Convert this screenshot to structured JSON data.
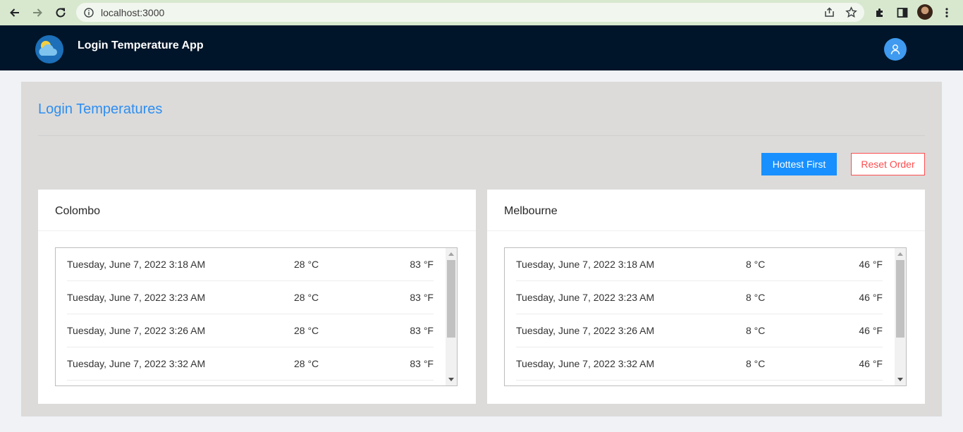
{
  "browser": {
    "url": "localhost:3000"
  },
  "app": {
    "title": "Login Temperature App"
  },
  "page": {
    "title": "Login Temperatures",
    "hottest_first_label": "Hottest First",
    "reset_order_label": "Reset Order"
  },
  "cards": [
    {
      "city": "Colombo",
      "rows": [
        {
          "date": "Tuesday, June 7, 2022 3:18 AM",
          "celsius": "28 °C",
          "fahrenheit": "83 °F"
        },
        {
          "date": "Tuesday, June 7, 2022 3:23 AM",
          "celsius": "28 °C",
          "fahrenheit": "83 °F"
        },
        {
          "date": "Tuesday, June 7, 2022 3:26 AM",
          "celsius": "28 °C",
          "fahrenheit": "83 °F"
        },
        {
          "date": "Tuesday, June 7, 2022 3:32 AM",
          "celsius": "28 °C",
          "fahrenheit": "83 °F"
        }
      ]
    },
    {
      "city": "Melbourne",
      "rows": [
        {
          "date": "Tuesday, June 7, 2022 3:18 AM",
          "celsius": "8 °C",
          "fahrenheit": "46 °F"
        },
        {
          "date": "Tuesday, June 7, 2022 3:23 AM",
          "celsius": "8 °C",
          "fahrenheit": "46 °F"
        },
        {
          "date": "Tuesday, June 7, 2022 3:26 AM",
          "celsius": "8 °C",
          "fahrenheit": "46 °F"
        },
        {
          "date": "Tuesday, June 7, 2022 3:32 AM",
          "celsius": "8 °C",
          "fahrenheit": "46 °F"
        }
      ]
    }
  ],
  "icons": {
    "back": "arrow-left-icon",
    "forward": "arrow-right-icon",
    "reload": "reload-icon",
    "info": "info-icon",
    "share": "share-icon",
    "bookmark": "star-icon",
    "extensions": "puzzle-icon",
    "side_panel": "side-panel-icon",
    "menu": "kebab-menu-icon",
    "logo": "weather-cloud-sun-icon",
    "user": "user-icon"
  },
  "colors": {
    "header_bg": "#001529",
    "accent": "#1890ff",
    "danger": "#ff4d4f",
    "title_blue": "#2f8ef0"
  }
}
